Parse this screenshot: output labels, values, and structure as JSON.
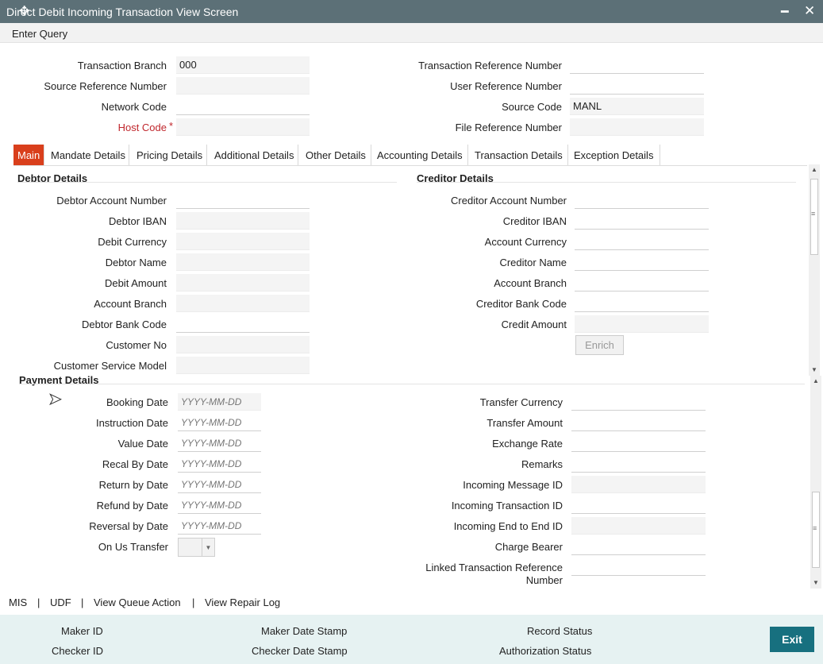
{
  "window": {
    "title": "Direct Debit Incoming Transaction View Screen"
  },
  "toolbar": {
    "enter_query": "Enter Query"
  },
  "header": {
    "transaction_branch_label": "Transaction Branch",
    "transaction_branch_value": "000",
    "source_ref_label": "Source Reference Number",
    "source_ref_value": "",
    "network_code_label": "Network Code",
    "network_code_value": "",
    "host_code_label": "Host Code",
    "host_code_value": "",
    "required_mark": "*",
    "txn_ref_label": "Transaction Reference Number",
    "txn_ref_value": "",
    "user_ref_label": "User Reference Number",
    "user_ref_value": "",
    "source_code_label": "Source Code",
    "source_code_value": "MANL",
    "file_ref_label": "File Reference Number",
    "file_ref_value": ""
  },
  "tabs": [
    "Main",
    "Mandate Details",
    "Pricing Details",
    "Additional Details",
    "Other Details",
    "Accounting Details",
    "Transaction Details",
    "Exception Details"
  ],
  "debtor": {
    "title": "Debtor Details",
    "account_number": "Debtor Account Number",
    "iban": "Debtor IBAN",
    "currency": "Debit Currency",
    "name": "Debtor Name",
    "amount": "Debit Amount",
    "branch": "Account Branch",
    "bank_code": "Debtor Bank Code",
    "customer_no": "Customer No",
    "service_model": "Customer Service Model"
  },
  "creditor": {
    "title": "Creditor Details",
    "account_number": "Creditor Account Number",
    "iban": "Creditor IBAN",
    "currency": "Account Currency",
    "name": "Creditor Name",
    "branch": "Account Branch",
    "bank_code": "Creditor Bank Code",
    "amount": "Credit Amount",
    "enrich": "Enrich"
  },
  "payment": {
    "title": "Payment Details",
    "date_placeholder": "YYYY-MM-DD",
    "booking_date": "Booking Date",
    "instruction_date": "Instruction Date",
    "value_date": "Value Date",
    "recal_by_date": "Recal By Date",
    "return_by_date": "Return by Date",
    "refund_by_date": "Refund by Date",
    "reversal_by_date": "Reversal by Date",
    "on_us_transfer": "On Us Transfer",
    "transfer_currency": "Transfer Currency",
    "transfer_amount": "Transfer Amount",
    "exchange_rate": "Exchange Rate",
    "remarks": "Remarks",
    "incoming_message_id": "Incoming Message ID",
    "incoming_txn_id": "Incoming Transaction ID",
    "incoming_e2e_id": "Incoming End to End ID",
    "charge_bearer": "Charge Bearer",
    "linked_txn_ref_1": "Linked Transaction Reference",
    "linked_txn_ref_2": "Number"
  },
  "links": {
    "mis": "MIS",
    "udf": "UDF",
    "view_queue": "View Queue Action",
    "view_repair": "View Repair Log",
    "separator": "|"
  },
  "audit": {
    "maker_id": "Maker ID",
    "checker_id": "Checker ID",
    "maker_date": "Maker Date Stamp",
    "checker_date": "Checker Date Stamp",
    "record_status": "Record Status",
    "auth_status": "Authorization Status",
    "exit": "Exit"
  }
}
